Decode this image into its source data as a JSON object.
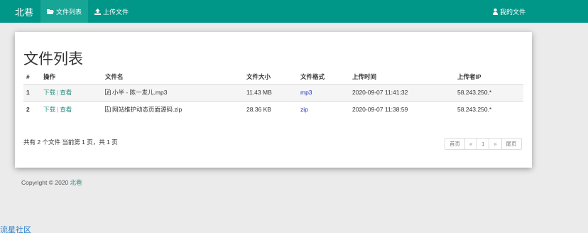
{
  "navbar": {
    "brand": "北巷",
    "items": [
      {
        "label": "文件列表",
        "icon": "folder-open-icon",
        "active": true
      },
      {
        "label": "上传文件",
        "icon": "upload-icon",
        "active": false
      }
    ],
    "right": {
      "label": "我的文件",
      "icon": "user-icon"
    },
    "color": "#009688"
  },
  "main": {
    "title": "文件列表",
    "columns": [
      "#",
      "操作",
      "文件名",
      "文件大小",
      "文件格式",
      "上传时间",
      "上传者IP"
    ],
    "rows": [
      {
        "num": "1",
        "download": "下载",
        "sep": "|",
        "view": "查看",
        "filename": "小半 - 陈一发儿.mp3",
        "file_icon": "audio-file-icon",
        "size": "11.43 MB",
        "format": "mp3",
        "time": "2020-09-07 11:41:32",
        "ip": "58.243.250.*"
      },
      {
        "num": "2",
        "download": "下载",
        "sep": "|",
        "view": "查看",
        "filename": "网站维护动态页面源码.zip",
        "file_icon": "archive-file-icon",
        "size": "28.36 KB",
        "format": "zip",
        "time": "2020-09-07 11:38:59",
        "ip": "58.243.250.*"
      }
    ],
    "summary": "共有 2 个文件  当前第 1 页，共 1 页",
    "pagination": [
      "首页",
      "«",
      "1",
      "»",
      "尾页"
    ]
  },
  "footer": {
    "copyright": "Copyright © 2020",
    "brand_link": "北巷"
  },
  "community_link": "流星社区"
}
